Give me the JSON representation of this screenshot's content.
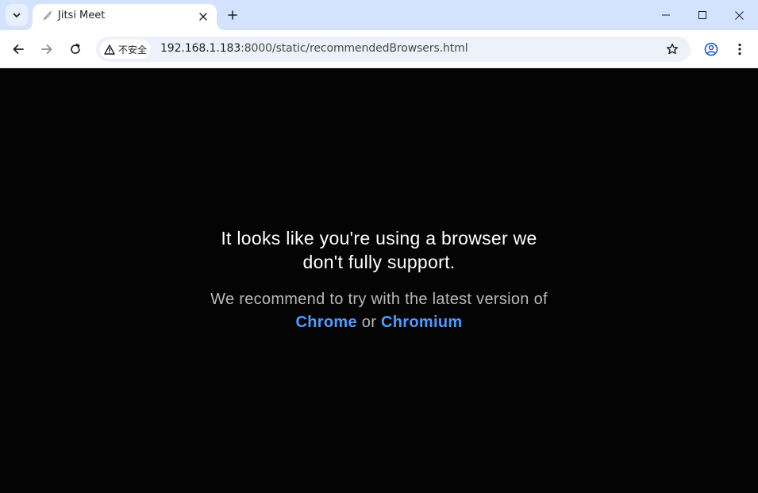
{
  "browser": {
    "tab": {
      "title": "Jitsi Meet"
    },
    "address": {
      "security_label": "不安全",
      "url_host": "192.168.1.183",
      "url_rest": ":8000/static/recommendedBrowsers.html"
    },
    "icons": {
      "tab_search": "chevron-down-icon",
      "favicon": "jitsi-feather-icon",
      "close": "close-icon",
      "new_tab": "plus-icon",
      "back": "arrow-left-icon",
      "forward": "arrow-right-icon",
      "reload": "reload-icon",
      "warning": "warning-triangle-icon",
      "bookmark": "star-icon",
      "profile": "profile-icon",
      "menu": "kebab-menu-icon"
    },
    "colors": {
      "tabstrip": "#d3e3fd",
      "omnibox": "#edf2fa",
      "link": "#4f9cff"
    }
  },
  "page": {
    "headline_line1": "It looks like you're using a browser we",
    "headline_line2": "don't fully support.",
    "recommend_text": "We recommend to try with the latest version of",
    "link_chrome": "Chrome",
    "or_text": "or",
    "link_chromium": "Chromium"
  }
}
